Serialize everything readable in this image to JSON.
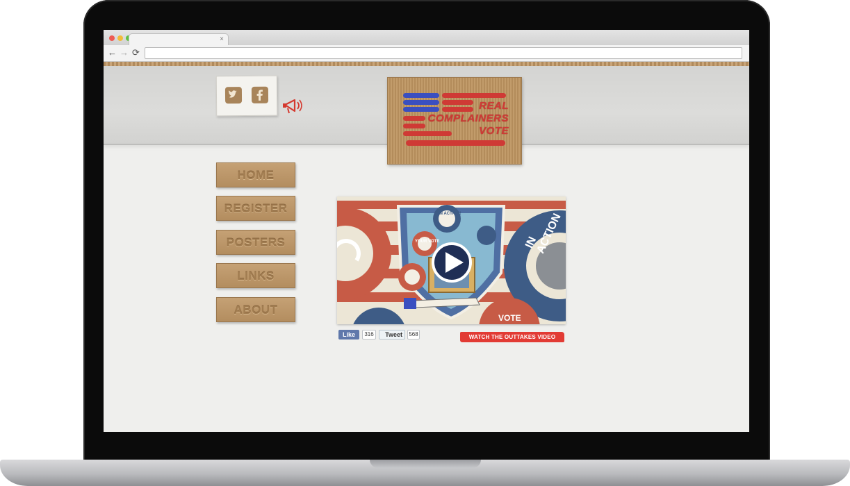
{
  "browser": {
    "tab_title": "",
    "tab_close": "×",
    "back": "←",
    "forward": "→",
    "reload": "⟳",
    "url": ""
  },
  "site": {
    "logo": {
      "line1": "REAL",
      "line2": "COMPLAINERS",
      "line3": "VOTE"
    },
    "social": {
      "twitter_icon": "twitter-icon",
      "facebook_icon": "facebook-icon"
    },
    "nav": [
      "HOME",
      "REGISTER",
      "POSTERS",
      "LINKS",
      "ABOUT"
    ],
    "video": {
      "badge_in_action": "IN ACTION!",
      "badge_your_vote": "YOUR VOTE",
      "big_gear_text": "IN ACTION",
      "bottom_text": "VOTE"
    },
    "facebook_like": {
      "label": "Like",
      "count": "316"
    },
    "tweet": {
      "label": "Tweet",
      "count": "568"
    },
    "outtakes_link": "WATCH THE OUTTAKES VIDEO"
  },
  "colors": {
    "brand_red": "#cf3a35",
    "brand_blue": "#3a4fc0",
    "cardboard": "#b89266",
    "facebook_blue": "#5f78ab",
    "outtakes_red": "#e23b34"
  }
}
